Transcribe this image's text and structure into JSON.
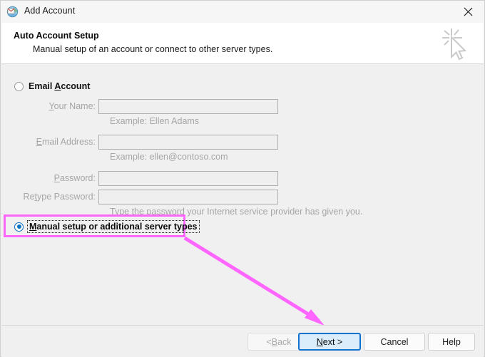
{
  "window": {
    "title": "Add Account",
    "app_icon": "globe-envelope-icon",
    "close_icon": "close-icon"
  },
  "header": {
    "title": "Auto Account Setup",
    "subtitle": "Manual setup of an account or connect to other server types.",
    "graphic_icon": "cursor-sparkle-icon"
  },
  "form": {
    "email_account": {
      "label": "Email Account",
      "selected": false
    },
    "fields": [
      {
        "label": "Your Name:",
        "value": "",
        "placeholder": "",
        "hint": "Example: Ellen Adams",
        "disabled": true
      },
      {
        "label": "Email Address:",
        "value": "",
        "placeholder": "",
        "hint": "Example: ellen@contoso.com",
        "disabled": true
      },
      {
        "label": "Password:",
        "value": "",
        "placeholder": "",
        "hint": "",
        "disabled": true
      },
      {
        "label": "Retype Password:",
        "value": "",
        "placeholder": "",
        "hint": "Type the password your Internet service provider has given you.",
        "disabled": true
      }
    ],
    "manual_setup": {
      "label": "Manual setup or additional server types",
      "selected": true,
      "highlighted": true
    }
  },
  "annotation": {
    "highlight_color": "#ff66ff",
    "arrow_color": "#ff66ff",
    "arrow_from": "manual-setup-option",
    "arrow_to": "next-button"
  },
  "footer": {
    "buttons": [
      {
        "label": "< Back",
        "state": "disabled"
      },
      {
        "label": "Next >",
        "state": "default"
      },
      {
        "label": "Cancel",
        "state": "normal"
      },
      {
        "label": "Help",
        "state": "normal"
      }
    ]
  }
}
